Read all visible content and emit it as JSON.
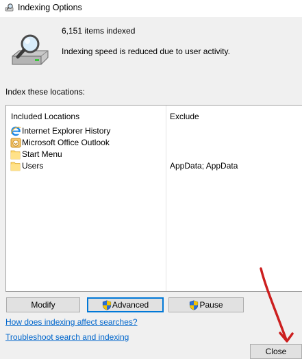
{
  "window": {
    "title": "Indexing Options",
    "icon": "indexing-options-icon"
  },
  "summary": {
    "items_indexed": "6,151 items indexed",
    "status": "Indexing speed is reduced due to user activity.",
    "icon": "hard-drive-magnifier-icon"
  },
  "locations": {
    "heading": "Index these locations:",
    "columns": {
      "included": "Included Locations",
      "exclude": "Exclude"
    },
    "rows": [
      {
        "label": "Internet Explorer History",
        "exclude": "",
        "icon": "internet-explorer-icon"
      },
      {
        "label": "Microsoft Office Outlook",
        "exclude": "",
        "icon": "outlook-icon"
      },
      {
        "label": "Start Menu",
        "exclude": "",
        "icon": "folder-icon"
      },
      {
        "label": "Users",
        "exclude": "AppData; AppData",
        "icon": "folder-icon"
      }
    ]
  },
  "buttons": {
    "modify": "Modify",
    "advanced": "Advanced",
    "pause": "Pause",
    "close": "Close"
  },
  "links": {
    "how_indexing": "How does indexing affect searches?",
    "troubleshoot": "Troubleshoot search and indexing"
  },
  "colors": {
    "background": "#f0f0f0",
    "link": "#0066cc",
    "default_button_border": "#0078d7",
    "annotation_arrow": "#cc1f1f"
  }
}
